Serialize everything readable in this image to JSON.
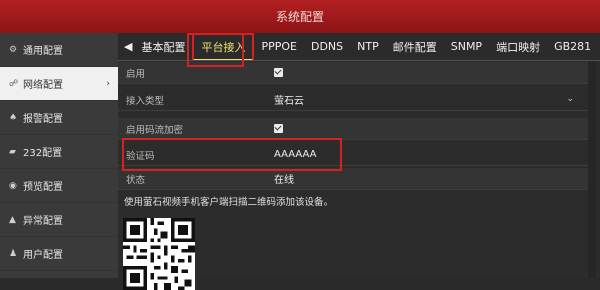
{
  "window": {
    "title": "系统配置"
  },
  "sidebar": {
    "items": [
      {
        "label": "通用配置",
        "icon": "gear-icon",
        "glyph": "⚙"
      },
      {
        "label": "网络配置",
        "icon": "network-icon",
        "glyph": "☍",
        "active": true,
        "arrow": "›"
      },
      {
        "label": "报警配置",
        "icon": "alarm-icon",
        "glyph": "♠"
      },
      {
        "label": "232配置",
        "icon": "serial-port-icon",
        "glyph": "▰"
      },
      {
        "label": "预览配置",
        "icon": "eye-icon",
        "glyph": "◉"
      },
      {
        "label": "异常配置",
        "icon": "warning-icon",
        "glyph": "▲"
      },
      {
        "label": "用户配置",
        "icon": "user-icon",
        "glyph": "♟"
      }
    ]
  },
  "tabs": {
    "left_arrow": "◀",
    "items": [
      "基本配置",
      "平台接入",
      "PPPOE",
      "DDNS",
      "NTP",
      "邮件配置",
      "SNMP",
      "端口映射",
      "GB281"
    ],
    "active_index": 1
  },
  "form": {
    "enable_label": "启用",
    "enable_checked": true,
    "access_type_label": "接入类型",
    "access_type_value": "萤石云",
    "stream_encrypt_label": "启用码流加密",
    "stream_encrypt_checked": true,
    "verify_code_label": "验证码",
    "verify_code_value": "AAAAAA",
    "status_label": "状态",
    "status_value": "在线"
  },
  "note": "使用萤石视频手机客户端扫描二维码添加该设备。",
  "colors": {
    "accent_red": "#d42222",
    "title_red": "#a81b1d",
    "tab_active": "#f0e070"
  }
}
